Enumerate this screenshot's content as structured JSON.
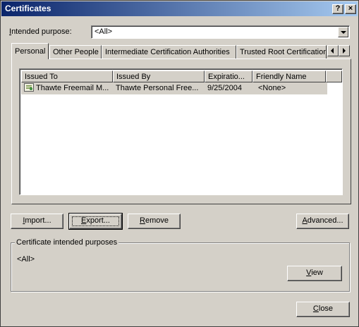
{
  "window": {
    "title": "Certificates",
    "help_glyph": "?",
    "close_glyph": "×"
  },
  "purpose": {
    "label_underlined": "I",
    "label_rest": "ntended purpose:",
    "selected": "<All>"
  },
  "tabs": [
    {
      "label": "Personal"
    },
    {
      "label": "Other People"
    },
    {
      "label": "Intermediate Certification Authorities"
    },
    {
      "label": "Trusted Root Certification"
    }
  ],
  "list": {
    "columns": [
      "Issued To",
      "Issued By",
      "Expiratio...",
      "Friendly Name"
    ],
    "rows": [
      {
        "issued_to": "Thawte Freemail M...",
        "issued_by": "Thawte Personal Free...",
        "expiration": "9/25/2004",
        "friendly_name": "<None>"
      }
    ]
  },
  "buttons": {
    "import": {
      "mnemonic": "I",
      "rest": "mport..."
    },
    "export": {
      "mnemonic": "E",
      "rest": "xport..."
    },
    "remove": {
      "mnemonic": "R",
      "rest": "emove"
    },
    "advanced": {
      "mnemonic": "A",
      "rest": "dvanced..."
    },
    "view": {
      "mnemonic": "V",
      "rest": "iew"
    },
    "close": {
      "mnemonic": "C",
      "rest": "lose"
    }
  },
  "purposes_group": {
    "title": "Certificate intended purposes",
    "value": "<All>"
  }
}
